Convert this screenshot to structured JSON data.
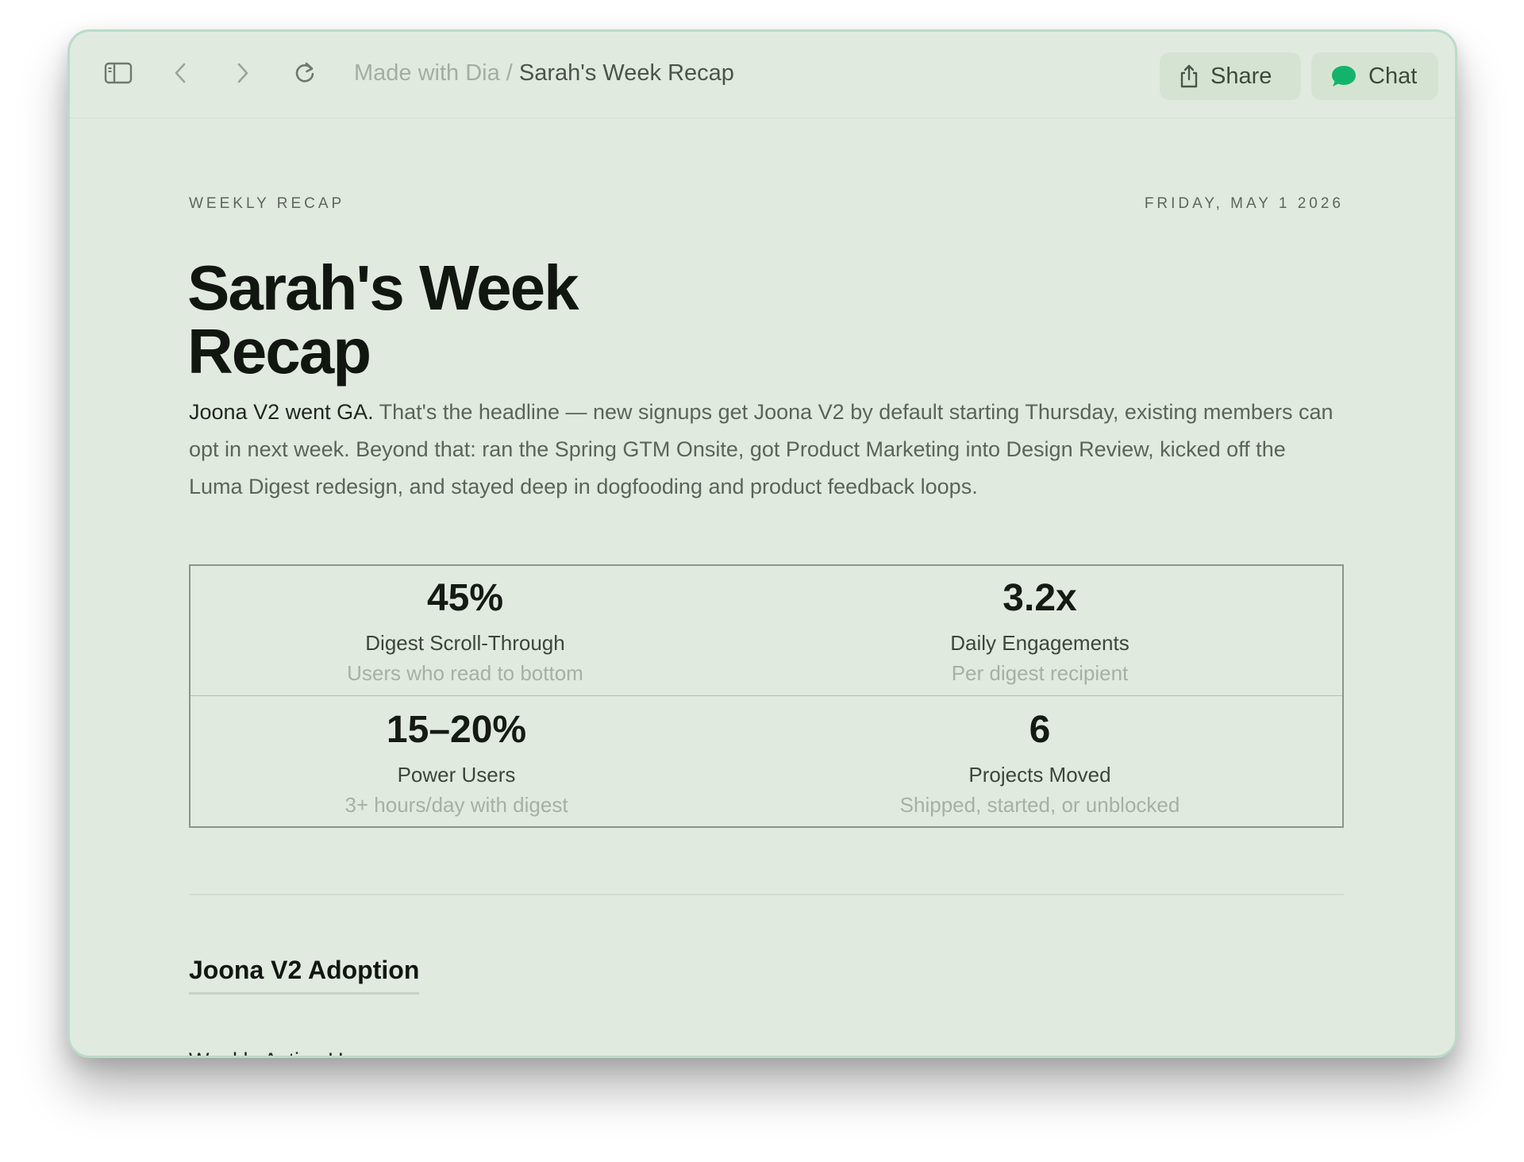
{
  "toolbar": {
    "breadcrumb_parent": "Made with Dia",
    "breadcrumb_separator": " / ",
    "breadcrumb_current": "Sarah's Week Recap",
    "share_label": "Share",
    "chat_label": "Chat",
    "icons": {
      "sidebar": "sidebar-toggle-icon",
      "back": "chevron-left-icon",
      "forward": "chevron-right-icon",
      "reload": "reload-icon",
      "share": "share-icon",
      "chat": "chat-bubble-icon"
    },
    "chat_icon_color": "#14b36b"
  },
  "page": {
    "kicker": "WEEKLY RECAP",
    "date": "FRIDAY, MAY 1 2026",
    "title_line1": "Sarah's Week",
    "title_line2": "Recap",
    "intro_lead": "Joona V2 went GA.",
    "intro_rest": " That's the headline — new signups get Joona V2 by default starting Thursday, existing members can opt in next week. Beyond that: ran the Spring GTM Onsite, got Product Marketing into Design Review, kicked off the Luma Digest redesign, and stayed deep in dogfooding and product feedback loops."
  },
  "stats": [
    {
      "value": "45%",
      "label": "Digest Scroll-Through",
      "sub": "Users who read to bottom"
    },
    {
      "value": "3.2x",
      "label": "Daily Engagements",
      "sub": "Per digest recipient"
    },
    {
      "value": "15–20%",
      "label": "Power Users",
      "sub": "3+ hours/day with digest"
    },
    {
      "value": "6",
      "label": "Projects Moved",
      "sub": "Shipped, started, or unblocked"
    }
  ],
  "section": {
    "title": "Joona V2 Adoption",
    "subhead": "Weekly Active Users"
  }
}
